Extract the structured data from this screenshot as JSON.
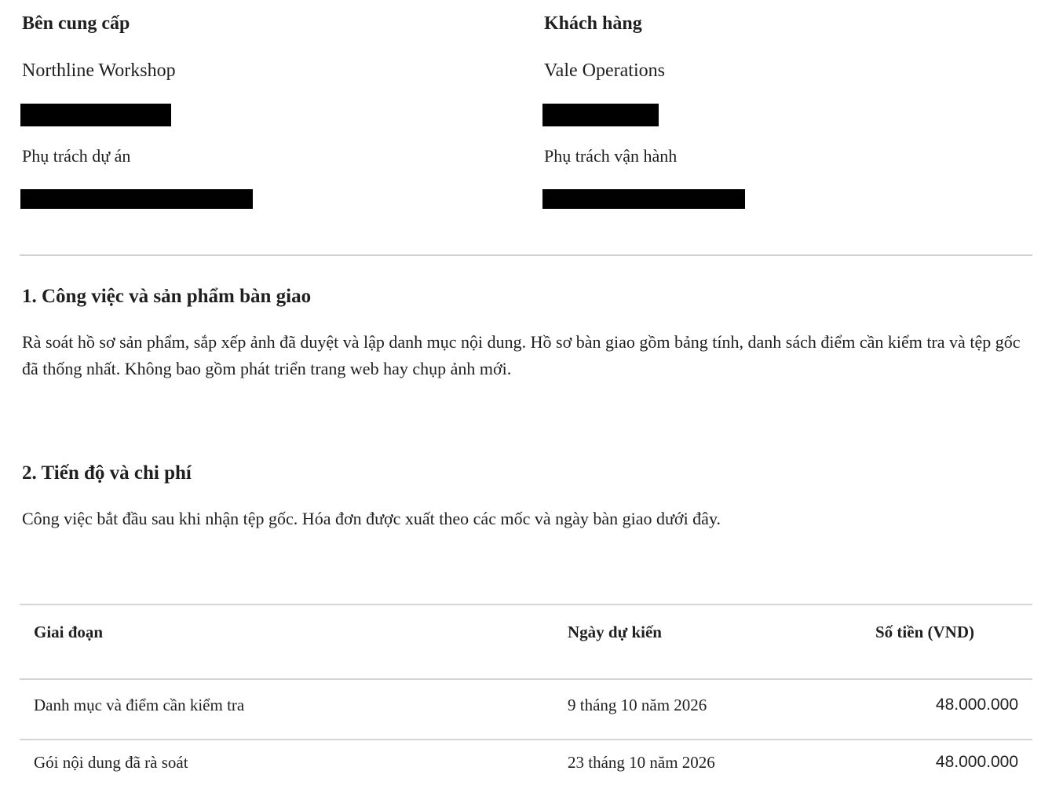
{
  "supplier": {
    "label": "Bên cung cấp",
    "name": "Northline Workshop",
    "role_label": "Phụ trách dự án"
  },
  "client": {
    "label": "Khách hàng",
    "name": "Vale Operations",
    "role_label": "Phụ trách vận hành"
  },
  "section1": {
    "title": "1. Công việc và sản phẩm bàn giao",
    "body": "Rà soát hồ sơ sản phẩm, sắp xếp ảnh đã duyệt và lập danh mục nội dung. Hồ sơ bàn giao gồm bảng tính, danh sách điểm cần kiểm tra và tệp gốc đã thống nhất. Không bao gồm phát triển trang web hay chụp ảnh mới."
  },
  "section2": {
    "title": "2. Tiến độ và chi phí",
    "body": "Công việc bắt đầu sau khi nhận tệp gốc. Hóa đơn được xuất theo các mốc và ngày bàn giao dưới đây."
  },
  "table": {
    "headers": [
      "Giai đoạn",
      "Ngày dự kiến",
      "Số tiền (VND)"
    ],
    "rows": [
      {
        "phase": "Danh mục và điểm cần kiểm tra",
        "date": "9 tháng 10 năm 2026",
        "amount": "48.000.000"
      },
      {
        "phase": "Gói nội dung đã rà soát",
        "date": "23 tháng 10 năm 2026",
        "amount": "48.000.000"
      }
    ]
  }
}
